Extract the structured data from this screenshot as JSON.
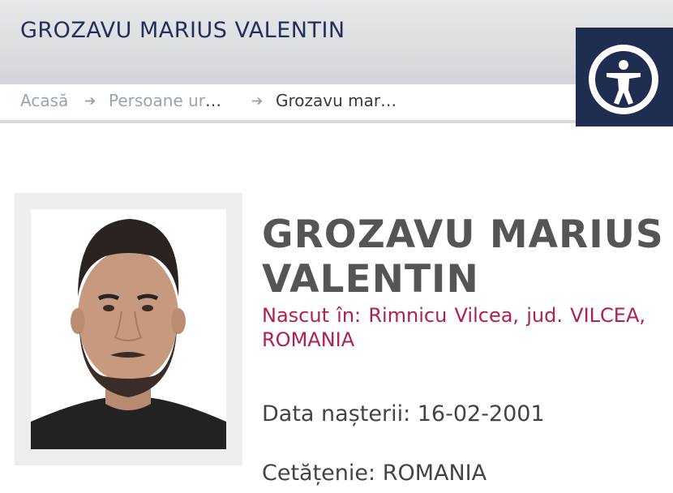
{
  "header": {
    "site_title": "GROZAVU MARIUS VALENTIN",
    "accessibility_icon": "accessibility-person-icon",
    "colors": {
      "title": "#22305a",
      "accessibility_bg": "#1f2d50"
    }
  },
  "breadcrumb": {
    "items": [
      {
        "label": "Acasă"
      },
      {
        "label": "Persoane ur",
        "ellipsis": "…"
      },
      {
        "label": "Grozavu mar…"
      }
    ],
    "separator_icon": "arrow-right-icon"
  },
  "profile": {
    "name": "GROZAVU MARIUS VALENTIN",
    "birthplace": "Nascut în: Rimnicu Vilcea, jud. VILCEA, ROMANIA",
    "birth_date": "Data nașterii: 16-02-2001",
    "citizenship": "Cetățenie: ROMANIA",
    "colors": {
      "name": "#555555",
      "birthplace": "#b0224d"
    }
  }
}
